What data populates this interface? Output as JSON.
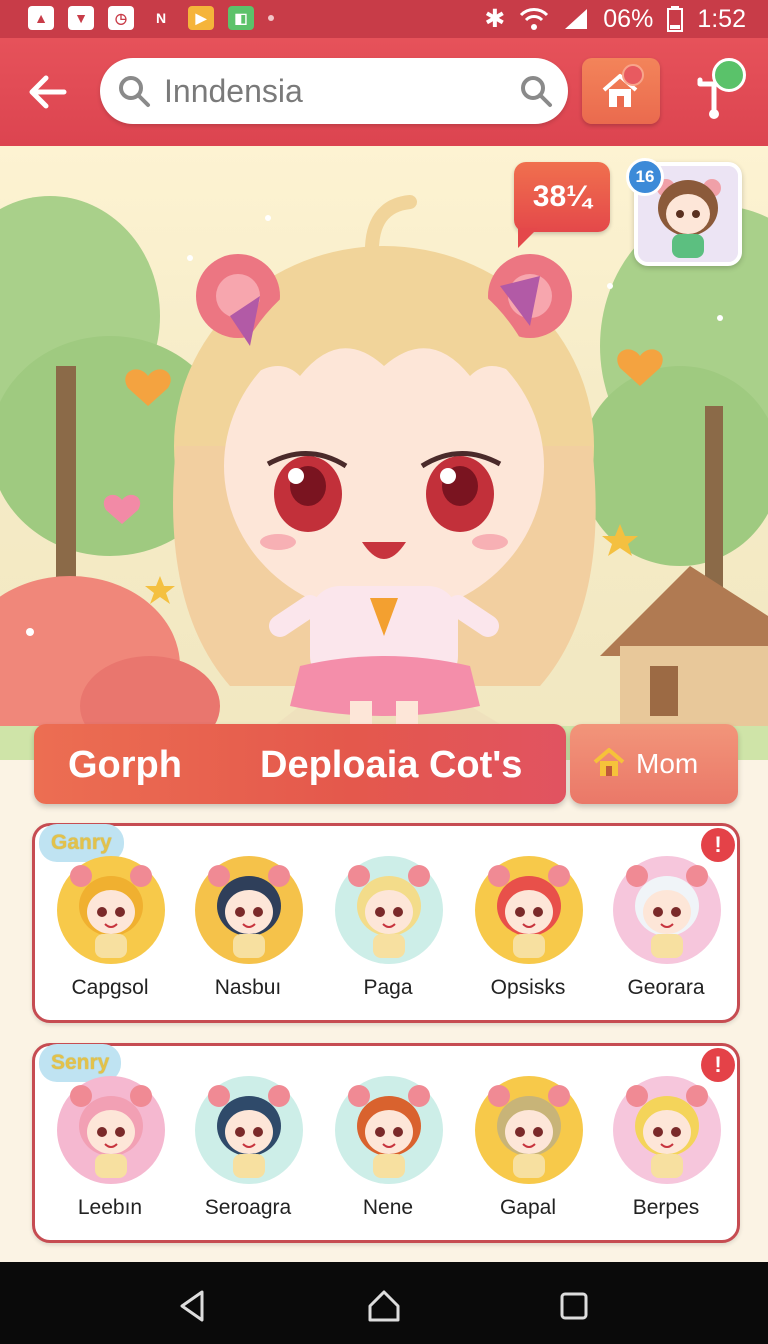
{
  "status_bar": {
    "battery": "06%",
    "time": "1:52"
  },
  "header": {
    "search_value": "Inndensia"
  },
  "hero": {
    "speech_bubble": "38¼",
    "level_badge": "16"
  },
  "actions": {
    "gorph_label": "Gorph",
    "deploaia_label": "Deploaia Cot's",
    "mom_label": "Mom"
  },
  "rows": [
    {
      "tag": "Ganry",
      "alert": "!",
      "characters": [
        {
          "name": "Capgsol",
          "bg": "#f7c94a",
          "hair": "#f0b030"
        },
        {
          "name": "Nasbuı",
          "bg": "#f5c24a",
          "hair": "#2f3f5a"
        },
        {
          "name": "Paga",
          "bg": "#cdeee8",
          "hair": "#f3dc8a"
        },
        {
          "name": "Opsisks",
          "bg": "#f7c94a",
          "hair": "#e8504a"
        },
        {
          "name": "Georara",
          "bg": "#f6c6dc",
          "hair": "#f0f4f8"
        }
      ]
    },
    {
      "tag": "Senry",
      "alert": "!",
      "characters": [
        {
          "name": "Leebın",
          "bg": "#f5b8d0",
          "hair": "#f2a0b4"
        },
        {
          "name": "Seroagra",
          "bg": "#cdeee8",
          "hair": "#2f4a6a"
        },
        {
          "name": "Nene",
          "bg": "#cdeee8",
          "hair": "#d9622e"
        },
        {
          "name": "Gapal",
          "bg": "#f7c94a",
          "hair": "#c8b478"
        },
        {
          "name": "Berpes",
          "bg": "#f6c6dc",
          "hair": "#f4d45a"
        }
      ]
    }
  ],
  "colors": {
    "brand": "#dc4450",
    "accent": "#ec6e52",
    "row_border": "#c64c52"
  }
}
